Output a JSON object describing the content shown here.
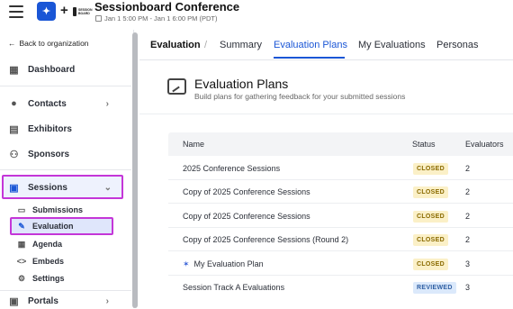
{
  "header": {
    "title": "Sessionboard Conference",
    "date": "Jan 1 5:00 PM - Jan 1 6:00 PM (PDT)",
    "logo_small_text": "SESSION BOARD"
  },
  "sidebar": {
    "back_label": "Back to organization",
    "items": [
      {
        "label": "Dashboard",
        "icon": "grid-icon"
      },
      {
        "label": "Contacts",
        "icon": "person-icon"
      },
      {
        "label": "Exhibitors",
        "icon": "store-icon"
      },
      {
        "label": "Sponsors",
        "icon": "group-icon"
      },
      {
        "label": "Sessions",
        "icon": "calendar-icon"
      },
      {
        "label": "Portals",
        "icon": "portal-icon"
      }
    ],
    "sub_items": [
      {
        "label": "Submissions",
        "icon": "document-icon"
      },
      {
        "label": "Evaluation",
        "icon": "evaluation-icon"
      },
      {
        "label": "Agenda",
        "icon": "calendar-small-icon"
      },
      {
        "label": "Embeds",
        "icon": "code-icon"
      },
      {
        "label": "Settings",
        "icon": "gear-icon"
      }
    ]
  },
  "tabs": {
    "crumb": "Evaluation",
    "items": [
      "Summary",
      "Evaluation Plans",
      "My Evaluations",
      "Personas"
    ],
    "active": "Evaluation Plans"
  },
  "page": {
    "title": "Evaluation Plans",
    "subtitle": "Build plans for gathering feedback for your submitted sessions"
  },
  "table": {
    "columns": [
      "Name",
      "Status",
      "Evaluators"
    ],
    "rows": [
      {
        "name": "2025 Conference Sessions",
        "status": "CLOSED",
        "evaluators": "2"
      },
      {
        "name": "Copy of 2025 Conference Sessions",
        "status": "CLOSED",
        "evaluators": "2"
      },
      {
        "name": "Copy of 2025 Conference Sessions",
        "status": "CLOSED",
        "evaluators": "2"
      },
      {
        "name": "Copy of 2025 Conference Sessions (Round 2)",
        "status": "CLOSED",
        "evaluators": "2"
      },
      {
        "name": "My Evaluation Plan",
        "status": "CLOSED",
        "evaluators": "3"
      },
      {
        "name": "Session Track A Evaluations",
        "status": "REVIEWED",
        "evaluators": "3"
      }
    ]
  },
  "colors": {
    "accent": "#1a56d6",
    "highlight_border": "#c436d8",
    "badge_closed_bg": "#fbf0c7",
    "badge_reviewed_bg": "#dbe9fb"
  }
}
